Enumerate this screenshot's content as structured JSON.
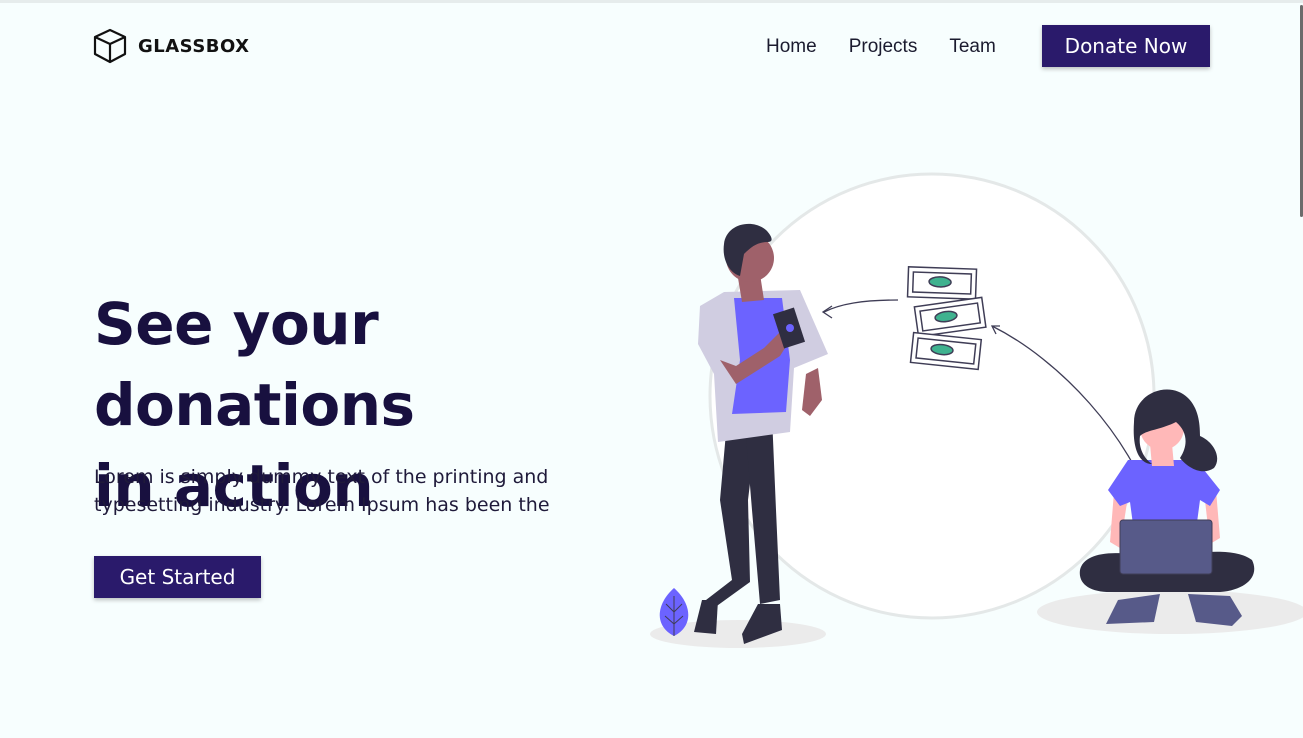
{
  "header": {
    "brand": "GLASSBOX",
    "nav": [
      {
        "label": "Home"
      },
      {
        "label": "Projects"
      },
      {
        "label": "Team"
      }
    ],
    "donate_label": "Donate Now"
  },
  "hero": {
    "title_line1": "See your donations",
    "title_line2": "in action",
    "text_line1": "Lorem is simply dummy text of the printing and",
    "text_line2": "typesetting industry. Lorem Ipsum has been the",
    "cta_label": "Get Started"
  },
  "colors": {
    "background": "#f7fefe",
    "brand": "#2a1a6b",
    "heading": "#18103f",
    "accent": "#6c63ff"
  },
  "icons": [
    "cube-logo-icon",
    "leaf-icon",
    "money-bills-icon"
  ]
}
